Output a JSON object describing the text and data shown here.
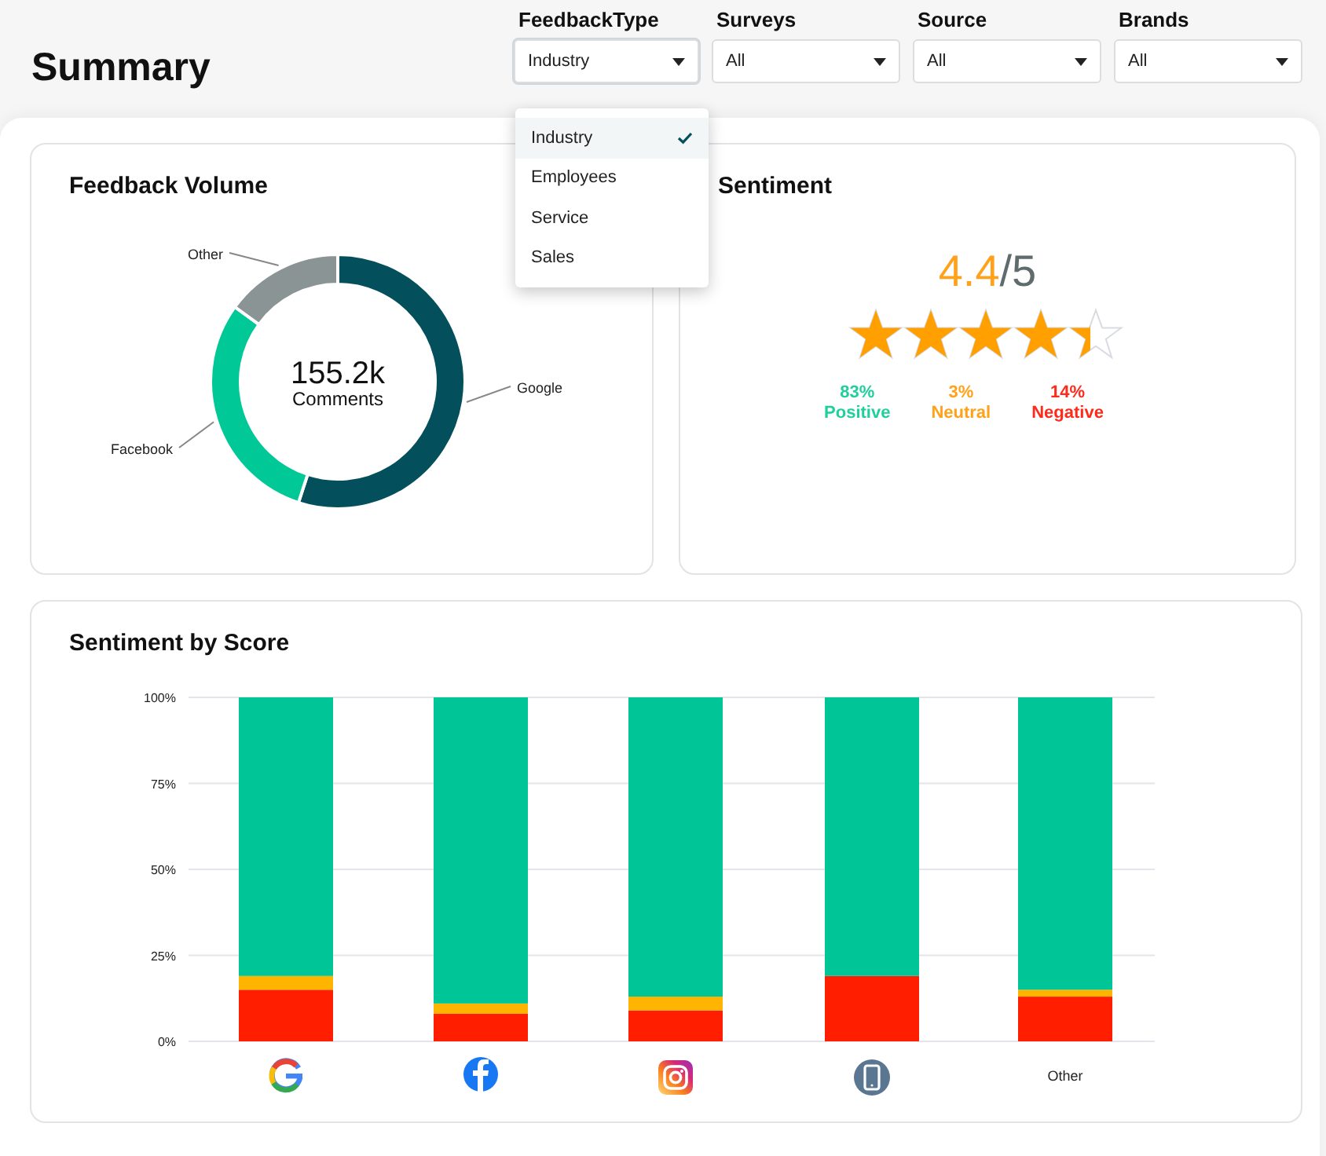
{
  "page": {
    "title": "Summary"
  },
  "filters": [
    {
      "label": "FeedbackType",
      "value": "Industry",
      "expanded": true
    },
    {
      "label": "Surveys",
      "value": "All",
      "expanded": false
    },
    {
      "label": "Source",
      "value": "All",
      "expanded": false
    },
    {
      "label": "Brands",
      "value": "All",
      "expanded": false
    }
  ],
  "dropdown_menu": [
    {
      "label": "Industry",
      "selected": true
    },
    {
      "label": "Employees",
      "selected": false
    },
    {
      "label": "Service",
      "selected": false
    },
    {
      "label": "Sales",
      "selected": false
    }
  ],
  "feedback_volume": {
    "title": "Feedback Volume",
    "total": "155.2k",
    "total_label": "Comments",
    "chart_data": {
      "type": "donut",
      "categories": [
        "Google",
        "Facebook",
        "Other"
      ],
      "series": [
        {
          "values": [
            55,
            30,
            15
          ]
        }
      ],
      "colors": [
        "#03505c",
        "#00c896",
        "#8a9495"
      ]
    }
  },
  "sentiment": {
    "title": "Sentiment",
    "score": "4.4",
    "max": "/5",
    "stars": 4.4,
    "stats": [
      {
        "value": "83%",
        "label": "Positive",
        "color": "#1fcf9c"
      },
      {
        "value": "3%",
        "label": "Neutral",
        "color": "#ffa21a"
      },
      {
        "value": "14%",
        "label": "Negative",
        "color": "#ff2a1a"
      }
    ]
  },
  "sentiment_by_score": {
    "title": "Sentiment by Score",
    "x_labels": [
      {
        "kind": "google"
      },
      {
        "kind": "facebook"
      },
      {
        "kind": "instagram"
      },
      {
        "kind": "phone"
      },
      {
        "kind": "text",
        "text": "Other"
      }
    ],
    "chart_data": {
      "type": "bar",
      "stacked": true,
      "grid": true,
      "ylim": [
        0,
        100
      ],
      "yticks": [
        {
          "value": 0,
          "label": "0%"
        },
        {
          "value": 25,
          "label": "25%"
        },
        {
          "value": 50,
          "label": "50%"
        },
        {
          "value": 75,
          "label": "75%"
        },
        {
          "value": 100,
          "label": "100%"
        }
      ],
      "series": [
        {
          "color": "#ff1f00",
          "values": [
            15,
            8,
            9,
            19,
            13
          ]
        },
        {
          "color": "#ffb400",
          "values": [
            4,
            3,
            4,
            0,
            2
          ]
        },
        {
          "color": "#00c596",
          "values": [
            81,
            89,
            87,
            81,
            85
          ]
        }
      ]
    }
  }
}
